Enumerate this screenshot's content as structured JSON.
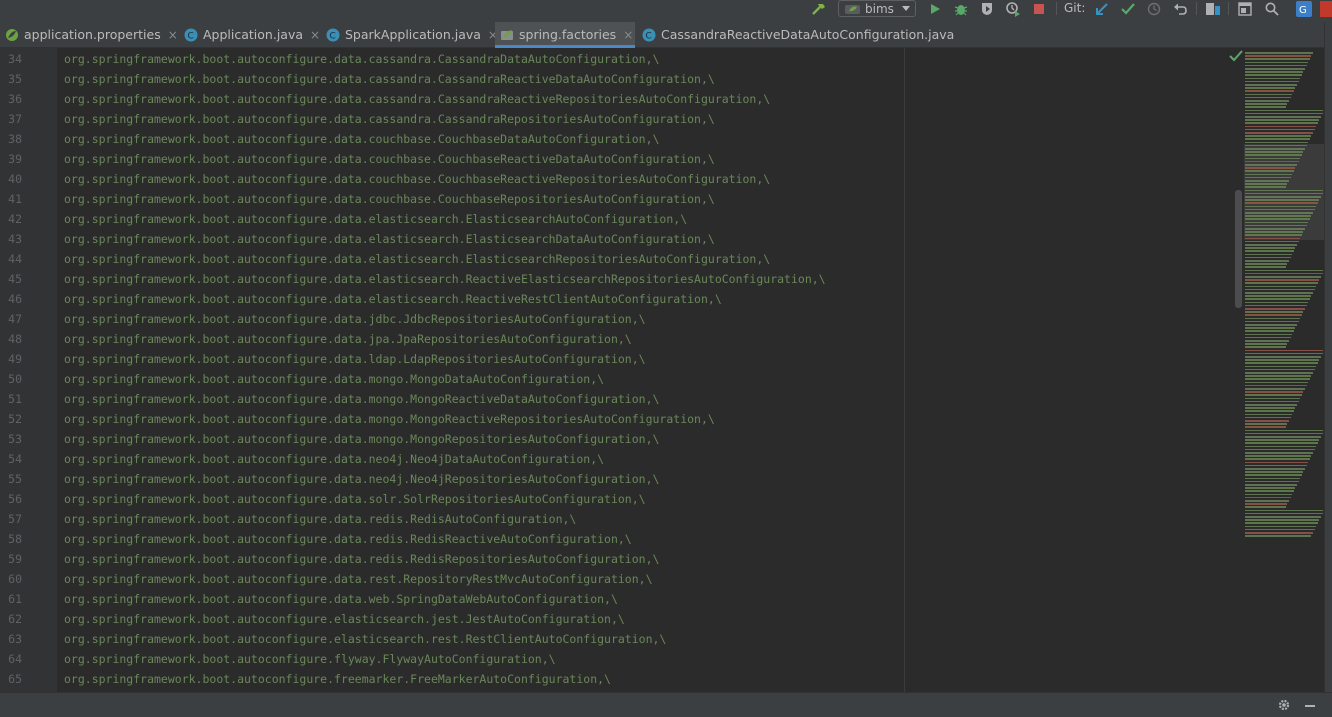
{
  "toolbar": {
    "run_config": "bims",
    "git_label": "Git:",
    "icons": [
      "hammer-icon",
      "run-icon",
      "debug-icon",
      "coverage-icon",
      "profile-icon",
      "stop-icon",
      "git-update-icon",
      "git-commit-icon",
      "history-icon",
      "revert-icon",
      "project-structure-icon",
      "layout-icon",
      "search-icon",
      "translate-icon"
    ]
  },
  "tabs": [
    {
      "label": "application.properties",
      "icon": "spring-leaf-icon",
      "active": false
    },
    {
      "label": "Application.java",
      "icon": "java-class-icon",
      "active": false
    },
    {
      "label": "SparkApplication.java",
      "icon": "java-class-icon",
      "active": false
    },
    {
      "label": "spring.factories",
      "icon": "spring-leaf-icon",
      "active": true
    },
    {
      "label": "CassandraReactiveDataAutoConfiguration.java",
      "icon": "java-class-icon",
      "active": false
    }
  ],
  "tab_close": "×",
  "editor": {
    "colors": {
      "background": "#2b2b2b",
      "gutter": "#313335",
      "string": "#6a8759",
      "line_number": "#606366"
    },
    "lines": [
      {
        "n": "34",
        "text": "org.springframework.boot.autoconfigure.data.cassandra.CassandraDataAutoConfiguration,\\"
      },
      {
        "n": "35",
        "text": "org.springframework.boot.autoconfigure.data.cassandra.CassandraReactiveDataAutoConfiguration,\\"
      },
      {
        "n": "36",
        "text": "org.springframework.boot.autoconfigure.data.cassandra.CassandraReactiveRepositoriesAutoConfiguration,\\"
      },
      {
        "n": "37",
        "text": "org.springframework.boot.autoconfigure.data.cassandra.CassandraRepositoriesAutoConfiguration,\\"
      },
      {
        "n": "38",
        "text": "org.springframework.boot.autoconfigure.data.couchbase.CouchbaseDataAutoConfiguration,\\"
      },
      {
        "n": "39",
        "text": "org.springframework.boot.autoconfigure.data.couchbase.CouchbaseReactiveDataAutoConfiguration,\\"
      },
      {
        "n": "40",
        "text": "org.springframework.boot.autoconfigure.data.couchbase.CouchbaseReactiveRepositoriesAutoConfiguration,\\"
      },
      {
        "n": "41",
        "text": "org.springframework.boot.autoconfigure.data.couchbase.CouchbaseRepositoriesAutoConfiguration,\\"
      },
      {
        "n": "42",
        "text": "org.springframework.boot.autoconfigure.data.elasticsearch.ElasticsearchAutoConfiguration,\\"
      },
      {
        "n": "43",
        "text": "org.springframework.boot.autoconfigure.data.elasticsearch.ElasticsearchDataAutoConfiguration,\\"
      },
      {
        "n": "44",
        "text": "org.springframework.boot.autoconfigure.data.elasticsearch.ElasticsearchRepositoriesAutoConfiguration,\\"
      },
      {
        "n": "45",
        "text": "org.springframework.boot.autoconfigure.data.elasticsearch.ReactiveElasticsearchRepositoriesAutoConfiguration,\\"
      },
      {
        "n": "46",
        "text": "org.springframework.boot.autoconfigure.data.elasticsearch.ReactiveRestClientAutoConfiguration,\\"
      },
      {
        "n": "47",
        "text": "org.springframework.boot.autoconfigure.data.jdbc.JdbcRepositoriesAutoConfiguration,\\"
      },
      {
        "n": "48",
        "text": "org.springframework.boot.autoconfigure.data.jpa.JpaRepositoriesAutoConfiguration,\\"
      },
      {
        "n": "49",
        "text": "org.springframework.boot.autoconfigure.data.ldap.LdapRepositoriesAutoConfiguration,\\"
      },
      {
        "n": "50",
        "text": "org.springframework.boot.autoconfigure.data.mongo.MongoDataAutoConfiguration,\\"
      },
      {
        "n": "51",
        "text": "org.springframework.boot.autoconfigure.data.mongo.MongoReactiveDataAutoConfiguration,\\"
      },
      {
        "n": "52",
        "text": "org.springframework.boot.autoconfigure.data.mongo.MongoReactiveRepositoriesAutoConfiguration,\\"
      },
      {
        "n": "53",
        "text": "org.springframework.boot.autoconfigure.data.mongo.MongoRepositoriesAutoConfiguration,\\"
      },
      {
        "n": "54",
        "text": "org.springframework.boot.autoconfigure.data.neo4j.Neo4jDataAutoConfiguration,\\"
      },
      {
        "n": "55",
        "text": "org.springframework.boot.autoconfigure.data.neo4j.Neo4jRepositoriesAutoConfiguration,\\"
      },
      {
        "n": "56",
        "text": "org.springframework.boot.autoconfigure.data.solr.SolrRepositoriesAutoConfiguration,\\"
      },
      {
        "n": "57",
        "text": "org.springframework.boot.autoconfigure.data.redis.RedisAutoConfiguration,\\"
      },
      {
        "n": "58",
        "text": "org.springframework.boot.autoconfigure.data.redis.RedisReactiveAutoConfiguration,\\"
      },
      {
        "n": "59",
        "text": "org.springframework.boot.autoconfigure.data.redis.RedisRepositoriesAutoConfiguration,\\"
      },
      {
        "n": "60",
        "text": "org.springframework.boot.autoconfigure.data.rest.RepositoryRestMvcAutoConfiguration,\\"
      },
      {
        "n": "61",
        "text": "org.springframework.boot.autoconfigure.data.web.SpringDataWebAutoConfiguration,\\"
      },
      {
        "n": "62",
        "text": "org.springframework.boot.autoconfigure.elasticsearch.jest.JestAutoConfiguration,\\"
      },
      {
        "n": "63",
        "text": "org.springframework.boot.autoconfigure.elasticsearch.rest.RestClientAutoConfiguration,\\"
      },
      {
        "n": "64",
        "text": "org.springframework.boot.autoconfigure.flyway.FlywayAutoConfiguration,\\"
      },
      {
        "n": "65",
        "text": "org.springframework.boot.autoconfigure.freemarker.FreeMarkerAutoConfiguration,\\"
      }
    ]
  },
  "status": {
    "icons": [
      "gear-icon",
      "minimize-icon"
    ]
  }
}
